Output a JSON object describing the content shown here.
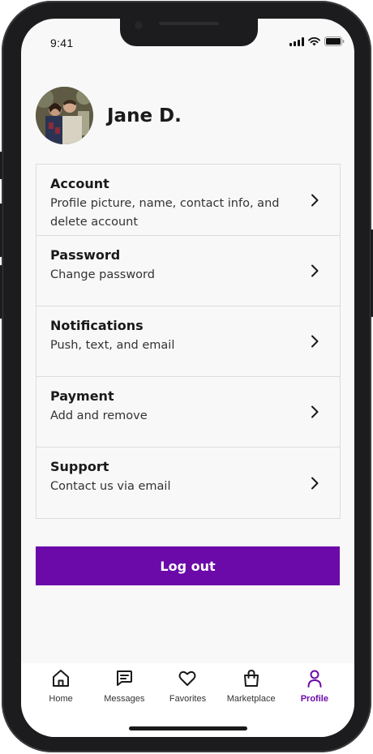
{
  "status_bar": {
    "time": "9:41"
  },
  "profile": {
    "name": "Jane D."
  },
  "menu": {
    "items": [
      {
        "title": "Account",
        "description": "Profile picture, name, contact info, and delete account"
      },
      {
        "title": "Password",
        "description": "Change password"
      },
      {
        "title": "Notifications",
        "description": "Push, text, and email"
      },
      {
        "title": "Payment",
        "description": "Add and remove"
      },
      {
        "title": "Support",
        "description": "Contact us via email"
      }
    ]
  },
  "logout": {
    "label": "Log out"
  },
  "tabs": [
    {
      "label": "Home",
      "icon": "home-icon"
    },
    {
      "label": "Messages",
      "icon": "messages-icon"
    },
    {
      "label": "Favorites",
      "icon": "heart-icon"
    },
    {
      "label": "Marketplace",
      "icon": "shopping-bag-icon"
    },
    {
      "label": "Profile",
      "icon": "profile-icon",
      "active": true
    }
  ],
  "colors": {
    "accent": "#6b0aa9",
    "background": "#f8f8f8",
    "divider": "#dcdcdc"
  }
}
